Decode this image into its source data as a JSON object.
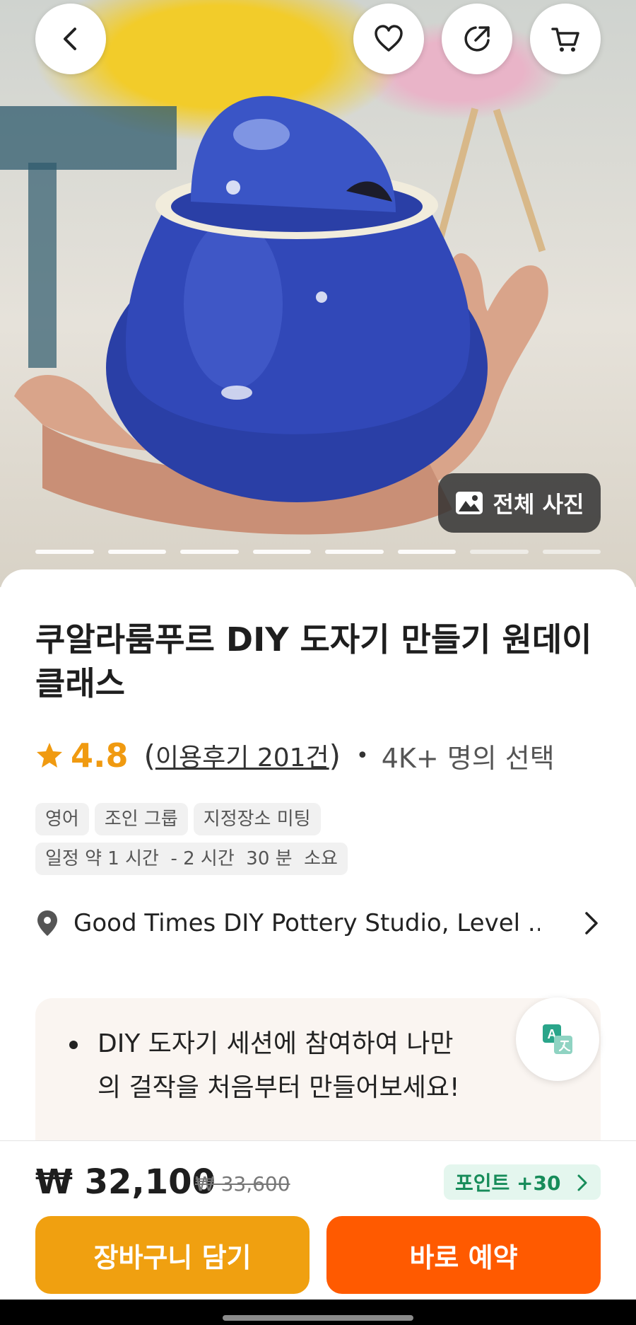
{
  "hero": {
    "all_photos_label": "전체 사진",
    "photo_count": 8,
    "current_photo": 6
  },
  "header": {
    "icons": [
      "back-arrow-icon",
      "heart-icon",
      "share-icon",
      "cart-icon"
    ]
  },
  "product": {
    "title": "쿠알라룸푸르 DIY 도자기 만들기 원데이 클래스",
    "rating": "4.8",
    "paren_open": "(",
    "reviews_label": "이용후기 201건",
    "paren_close": ")",
    "chosen_label": "4K+ 명의 선택",
    "tags": [
      "영어",
      "조인 그룹",
      "지정장소 미팅",
      "일정 약 1 시간  - 2 시간  30 분  소요"
    ],
    "location": "Good Times DIY Pottery Studio, Level ..."
  },
  "highlights": {
    "item_1": "DIY 도자기 세션에 참여하여 나만의 걸작을 처음부터 만들어보세요!"
  },
  "purchase": {
    "price": "₩ 32,100",
    "original_price": "₩ 33,600",
    "points_label": "포인트 +30",
    "add_to_cart_label": "장바구니 담기",
    "book_now_label": "바로 예약"
  },
  "colors": {
    "accent_orange": "#ff5a00",
    "cart_yellow": "#f0a010",
    "rating_star": "#f09a10",
    "points_green": "#178c5a"
  }
}
